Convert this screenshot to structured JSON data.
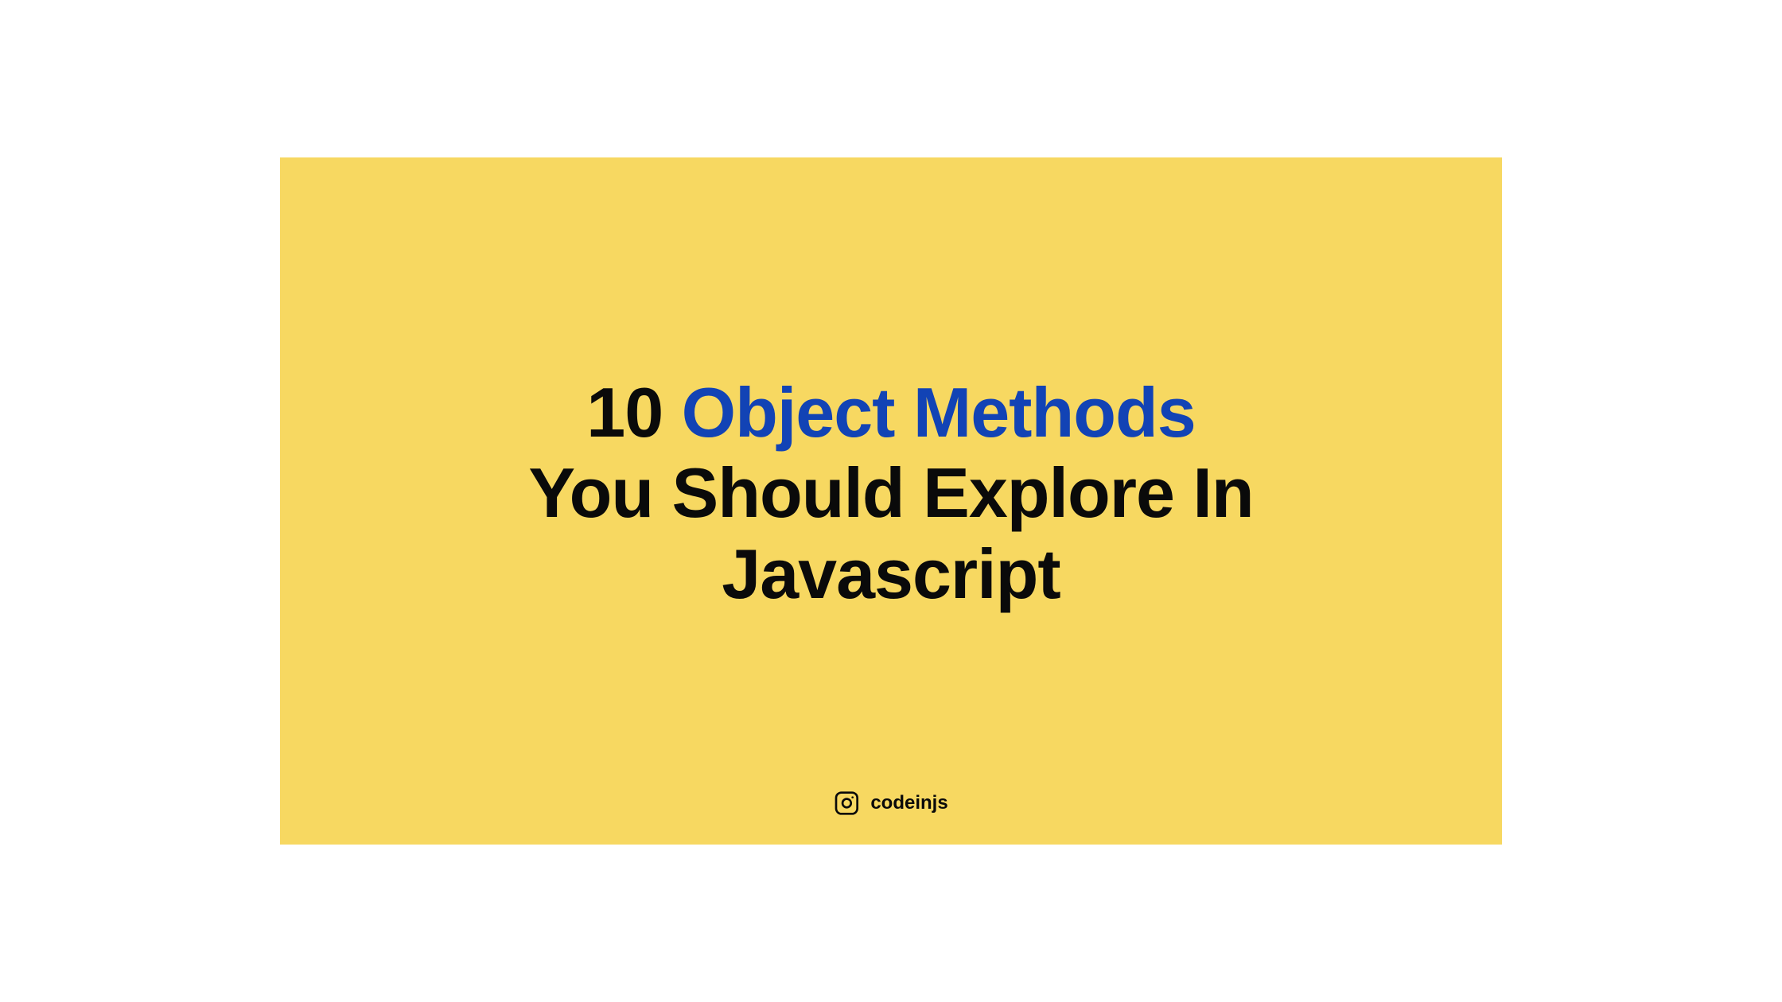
{
  "slide": {
    "title": {
      "prefix": "10 ",
      "highlight": "Object Methods",
      "line2": "You Should Explore In",
      "line3": "Javascript"
    },
    "footer": {
      "handle": "codeinjs",
      "icon_name": "instagram-icon"
    }
  },
  "colors": {
    "background": "#f7d861",
    "text_primary": "#0a0a0a",
    "text_highlight": "#1243b5"
  }
}
